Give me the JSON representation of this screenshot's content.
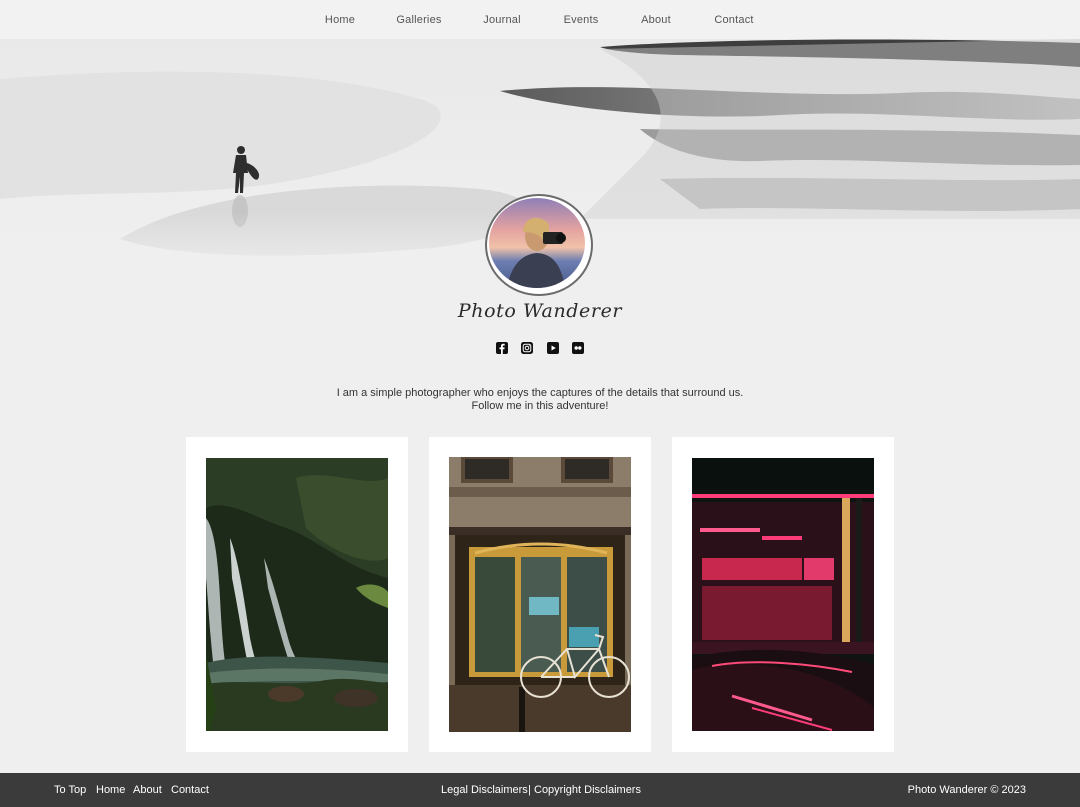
{
  "nav": {
    "items": [
      {
        "label": "Home"
      },
      {
        "label": "Galleries"
      },
      {
        "label": "Journal"
      },
      {
        "label": "Events"
      },
      {
        "label": "About"
      },
      {
        "label": "Contact"
      }
    ]
  },
  "hero": {
    "image": "beach-surfer-photo"
  },
  "profile": {
    "avatar": "photographer-with-camera-photo",
    "brand_name": "Photo Wanderer",
    "social": [
      "facebook-icon",
      "instagram-icon",
      "youtube-icon",
      "flickr-icon"
    ]
  },
  "intro": {
    "line1": "I am a simple photographer who enjoys the captures of the details that surround us.",
    "line2": "Follow me in this adventure!"
  },
  "gallery": {
    "photos": [
      {
        "subject": "waterfall-photo"
      },
      {
        "subject": "shop-front-with-bicycle-photo"
      },
      {
        "subject": "neon-street-night-photo"
      }
    ]
  },
  "footer": {
    "left_links": [
      {
        "label": "To Top"
      },
      {
        "label": "Home"
      },
      {
        "label": "About"
      },
      {
        "label": "Contact"
      }
    ],
    "legal": "Legal Disclaimers",
    "separator": "|",
    "copyright_link": "Copyright Disclaimers",
    "copyright": "Photo Wanderer © 2023"
  },
  "colors": {
    "page_bg": "#efefef",
    "nav_bg": "#f2f2f2",
    "footer_bg": "#3b3b3b"
  }
}
